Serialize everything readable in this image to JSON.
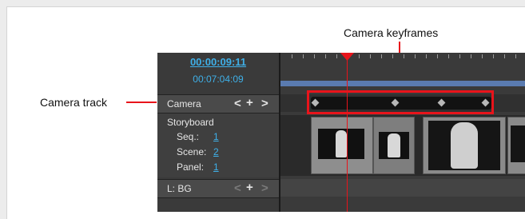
{
  "callouts": {
    "camera_keyframes": "Camera keyframes",
    "camera_track": "Camera track"
  },
  "timecode": {
    "current": "00:00:09:11",
    "total": "00:07:04:09"
  },
  "tracks": {
    "camera": {
      "label": "Camera",
      "prev": "<",
      "add": "+",
      "next": ">"
    },
    "storyboard": {
      "label": "Storyboard",
      "seq_label": "Seq.:",
      "seq_value": "1",
      "scene_label": "Scene:",
      "scene_value": "2",
      "panel_label": "Panel:",
      "panel_value": "1"
    },
    "layer": {
      "label": "L: BG",
      "prev": "<",
      "add": "+",
      "next": ">"
    }
  },
  "colors": {
    "highlight": "#e8141b",
    "timecode": "#3fb0e8"
  }
}
